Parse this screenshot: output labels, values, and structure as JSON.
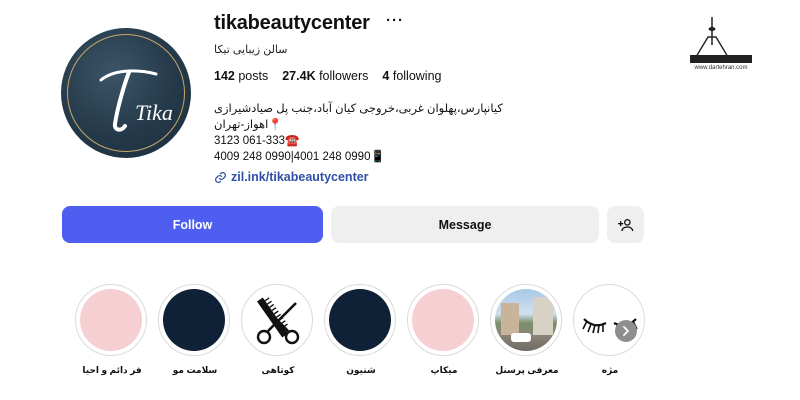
{
  "profile": {
    "username": "tikabeautycenter",
    "more_icon": "more-horizontal-icon",
    "full_name": "سالن زیبایی تیکا",
    "avatar_text": "Tika"
  },
  "stats": {
    "posts_count": "142",
    "posts_label": "posts",
    "followers_count": "27.4K",
    "followers_label": "followers",
    "following_count": "4",
    "following_label": "following"
  },
  "bio": {
    "line1": "کیانپارس،پهلوان غربی،خروجی کیان آباد،جنب پل صیادشیرازی",
    "line2": "📍اهواز-تهران",
    "line3": "3123 061-333☎️",
    "line4": "4009 248 0990|4001 248 0990📱"
  },
  "link": {
    "text": "zil.ink/tikabeautycenter",
    "icon": "link-icon"
  },
  "actions": {
    "follow_label": "Follow",
    "message_label": "Message",
    "add_user_icon": "add-user-icon"
  },
  "highlights": [
    {
      "label": "فر دائم و احیا",
      "style": "pink"
    },
    {
      "label": "سلامت مو",
      "style": "navy"
    },
    {
      "label": "کوتاهی",
      "style": "scissors"
    },
    {
      "label": "شنیون",
      "style": "navy"
    },
    {
      "label": "میکاپ",
      "style": "pink"
    },
    {
      "label": "معرفی پرسنل",
      "style": "photo"
    },
    {
      "label": "مژه",
      "style": "lashes"
    }
  ],
  "watermark": {
    "text": "www.dartehran.com"
  },
  "colors": {
    "follow": "#4f5ef0",
    "link": "#2f4fa8",
    "pink": "#f5cfd2",
    "navy": "#0f2137"
  }
}
